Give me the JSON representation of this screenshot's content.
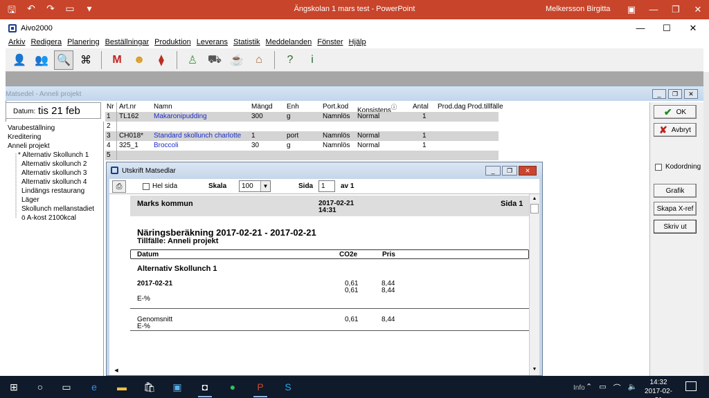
{
  "powerpoint": {
    "title": "Ängskolan 1 mars test  -  PowerPoint",
    "user": "Melkersson Birgitta"
  },
  "aivo": {
    "title": "Aivo2000",
    "menu": [
      "Arkiv",
      "Redigera",
      "Planering",
      "Beställningar",
      "Produktion",
      "Leverans",
      "Statistik",
      "Meddelanden",
      "Fönster",
      "Hjälp"
    ]
  },
  "matsedel": {
    "title": "Matsedel - Anneli projekt",
    "date_label": "Datum:",
    "date_value": "tis 21 feb",
    "tree": [
      "Varubeställning",
      "Kreditering",
      "Anneli projekt",
      "* Alternativ Skollunch 1",
      "Alternativ skollunch 2",
      "Alternativ skollunch 3",
      "Alternativ skollunch 4",
      "Lindängs restaurang",
      "Läger",
      "Skollunch mellanstadiet",
      "ö A-kost 2100kcal"
    ],
    "columns": [
      "Nr",
      "Art.nr",
      "Namn",
      "Mängd",
      "Enh",
      "Port.kod",
      "Konsistens",
      "Antal",
      "Prod.dag",
      "Prod.tillfälle"
    ],
    "rows": [
      {
        "nr": "1",
        "art": "TL162",
        "namn": "Makaronipudding",
        "mangd": "300",
        "enh": "g",
        "port": "Namnlös",
        "kons": "Normal",
        "antal": "1"
      },
      {
        "nr": "2",
        "art": "",
        "namn": "",
        "mangd": "",
        "enh": "",
        "port": "",
        "kons": "",
        "antal": ""
      },
      {
        "nr": "3",
        "art": "CH018*",
        "namn": "Standard skollunch charlotte",
        "mangd": "1",
        "enh": "port",
        "port": "Namnlös",
        "kons": "Normal",
        "antal": "1"
      },
      {
        "nr": "4",
        "art": "325_1",
        "namn": "Broccoli",
        "mangd": "30",
        "enh": "g",
        "port": "Namnlös",
        "kons": "Normal",
        "antal": "1"
      },
      {
        "nr": "5",
        "art": "",
        "namn": "",
        "mangd": "",
        "enh": "",
        "port": "",
        "kons": "",
        "antal": ""
      }
    ],
    "buttons": {
      "ok": "OK",
      "cancel": "Avbryt",
      "kodordning": "Kodordning",
      "grafik": "Grafik",
      "xref": "Skapa X-ref",
      "print": "Skriv ut"
    }
  },
  "utskrift": {
    "title": "Utskrift Matsedlar",
    "hel_sida": "Hel sida",
    "skala_label": "Skala",
    "skala_value": "100",
    "sida_label": "Sida",
    "sida_value": "1",
    "av": "av 1",
    "report": {
      "org": "Marks kommun",
      "date": "2017-02-21",
      "time": "14:31",
      "page": "Sida 1",
      "heading": "Näringsberäkning 2017-02-21 - 2017-02-21",
      "tillfalle": "Tillfälle:  Anneli projekt",
      "col_datum": "Datum",
      "col_co2": "CO2e",
      "col_pris": "Pris",
      "group": "Alternativ Skollunch 1",
      "row_date": "2017-02-21",
      "co2_1": "0,61",
      "co2_2": "0,61",
      "pris_1": "8,44",
      "pris_2": "8,44",
      "e_pct": "E-%",
      "snitt": "Genomsnitt",
      "snitt_co2": "0,61",
      "snitt_pris": "8,44",
      "snitt_e": "E-%"
    }
  },
  "taskbar": {
    "time": "14:32",
    "date": "2017-02-21",
    "info": "Info"
  }
}
